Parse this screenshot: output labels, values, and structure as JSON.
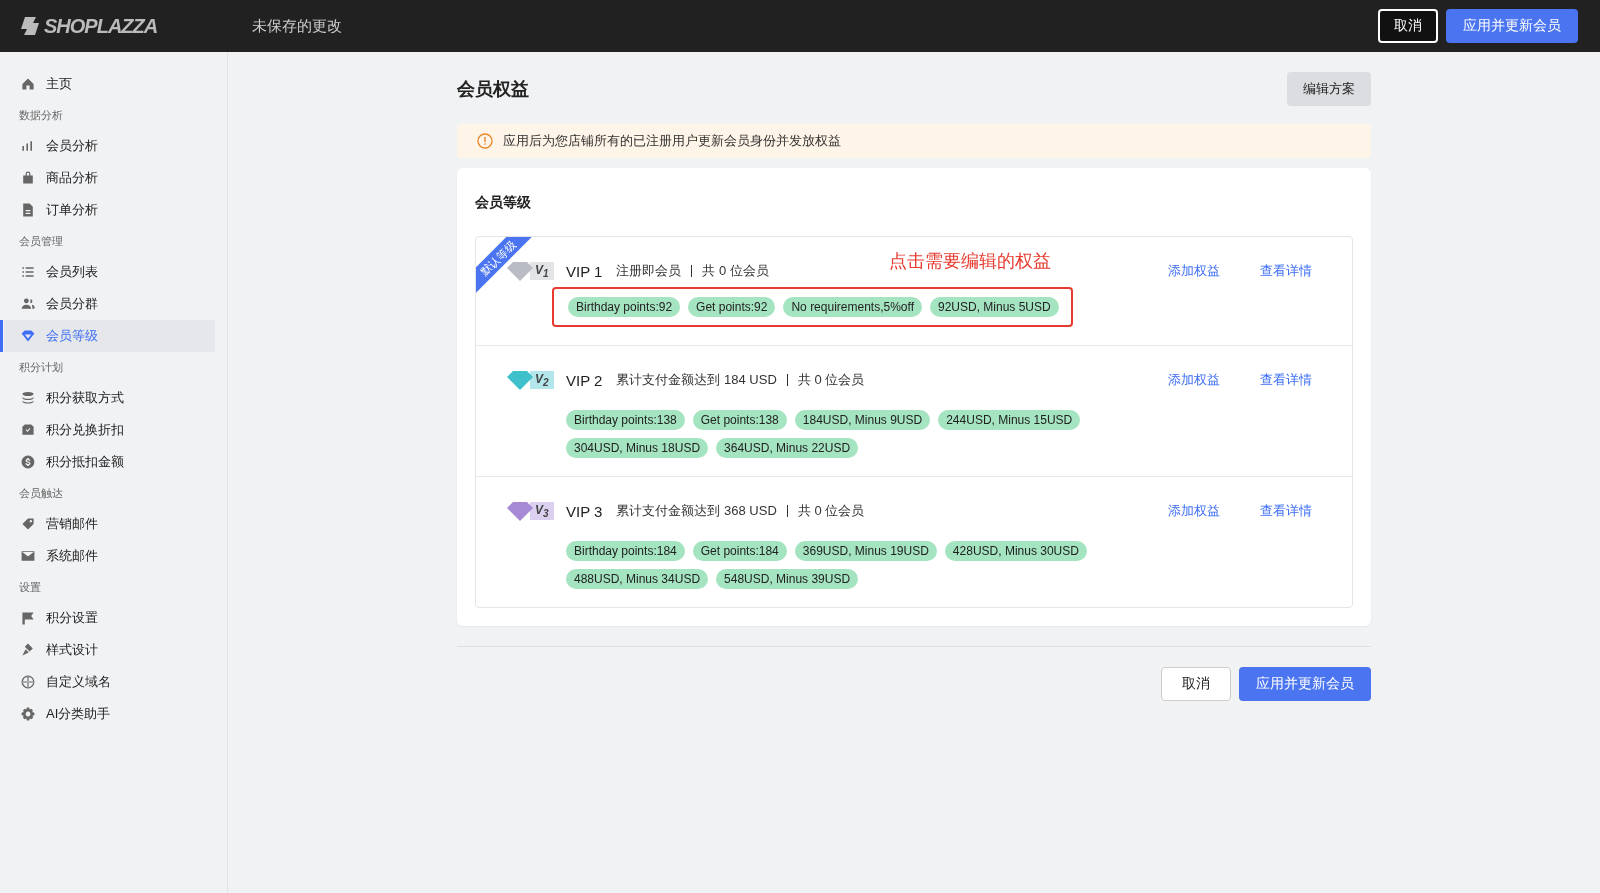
{
  "topbar": {
    "logo": "SHOPLAZZA",
    "status": "未保存的更改",
    "cancel": "取消",
    "apply": "应用并更新会员"
  },
  "sidebar": [
    {
      "kind": "item",
      "label": "主页",
      "selected": false
    },
    {
      "kind": "group",
      "label": "数据分析"
    },
    {
      "kind": "item",
      "label": "会员分析",
      "selected": false
    },
    {
      "kind": "item",
      "label": "商品分析",
      "selected": false
    },
    {
      "kind": "item",
      "label": "订单分析",
      "selected": false
    },
    {
      "kind": "group",
      "label": "会员管理"
    },
    {
      "kind": "item",
      "label": "会员列表",
      "selected": false
    },
    {
      "kind": "item",
      "label": "会员分群",
      "selected": false
    },
    {
      "kind": "item",
      "label": "会员等级",
      "selected": true
    },
    {
      "kind": "group",
      "label": "积分计划"
    },
    {
      "kind": "item",
      "label": "积分获取方式",
      "selected": false
    },
    {
      "kind": "item",
      "label": "积分兑换折扣",
      "selected": false
    },
    {
      "kind": "item",
      "label": "积分抵扣金额",
      "selected": false
    },
    {
      "kind": "group",
      "label": "会员触达"
    },
    {
      "kind": "item",
      "label": "营销邮件",
      "selected": false
    },
    {
      "kind": "item",
      "label": "系统邮件",
      "selected": false
    },
    {
      "kind": "group",
      "label": "设置"
    },
    {
      "kind": "item",
      "label": "积分设置",
      "selected": false
    },
    {
      "kind": "item",
      "label": "样式设计",
      "selected": false
    },
    {
      "kind": "item",
      "label": "自定义域名",
      "selected": false
    },
    {
      "kind": "item",
      "label": "AI分类助手",
      "selected": false
    }
  ],
  "page": {
    "title": "会员权益",
    "edit_button": "编辑方案",
    "alert": "应用后为您店铺所有的已注册用户更新会员身份并发放权益"
  },
  "levels_card": {
    "title": "会员等级",
    "tiers": [
      {
        "name": "VIP 1",
        "badge": "V$_{1}$",
        "color": "#b9bcc4",
        "ribbon": "默认等级",
        "condition": "注册即会员",
        "members": "共 0 位会员",
        "highlighted": true,
        "annotation": "点击需要编辑的权益",
        "add": "添加权益",
        "details": "查看详情",
        "benefits": [
          "Birthday points:92",
          "Get points:92",
          "No requirements,5%off",
          "92USD, Minus 5USD"
        ]
      },
      {
        "name": "VIP 2",
        "badge": "V$_{2}$",
        "color": "#3fc1cc",
        "condition": "累计支付金额达到 184 USD",
        "members": "共 0 位会员",
        "highlighted": false,
        "add": "添加权益",
        "details": "查看详情",
        "benefits": [
          "Birthday points:138",
          "Get points:138",
          "184USD, Minus 9USD",
          "244USD, Minus 15USD",
          "304USD, Minus 18USD",
          "364USD, Minus 22USD"
        ]
      },
      {
        "name": "VIP 3",
        "badge": "V$_{3}$",
        "color": "#a68ad6",
        "condition": "累计支付金额达到 368 USD",
        "members": "共 0 位会员",
        "highlighted": false,
        "add": "添加权益",
        "details": "查看详情",
        "benefits": [
          "Birthday points:184",
          "Get points:184",
          "369USD, Minus 19USD",
          "428USD, Minus 30USD",
          "488USD, Minus 34USD",
          "548USD, Minus 39USD"
        ]
      }
    ]
  },
  "footer": {
    "cancel": "取消",
    "apply": "应用并更新会员"
  }
}
